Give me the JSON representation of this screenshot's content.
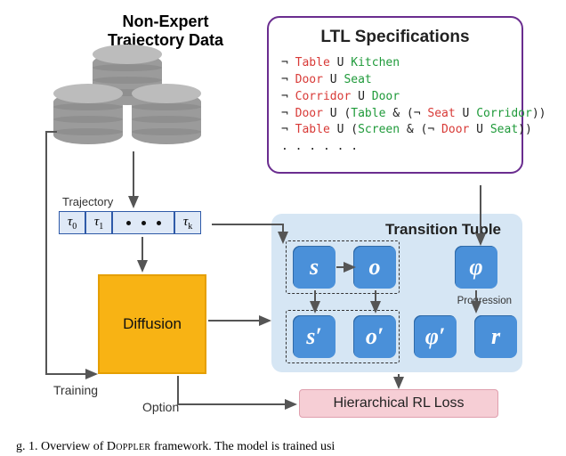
{
  "headers": {
    "nonexpert_line1": "Non-Expert",
    "nonexpert_line2": "Trajectory Data",
    "ltl": "LTL Specifications",
    "trajectory": "Trajectory",
    "transition": "Transition Tuple",
    "diffusion": "Diffusion",
    "progression": "Progression",
    "rl_loss": "Hierarchical RL Loss",
    "training": "Training",
    "option": "Option"
  },
  "ltl_specs": [
    [
      {
        "op": "¬ "
      },
      {
        "red": "Table"
      },
      {
        "op": " U "
      },
      {
        "grn": "Kitchen"
      }
    ],
    [
      {
        "op": "¬ "
      },
      {
        "red": "Door"
      },
      {
        "op": " U "
      },
      {
        "grn": "Seat"
      }
    ],
    [
      {
        "op": "¬ "
      },
      {
        "red": "Corridor"
      },
      {
        "op": " U "
      },
      {
        "grn": "Door"
      }
    ],
    [
      {
        "op": "¬ "
      },
      {
        "red": "Door"
      },
      {
        "op": " U ("
      },
      {
        "grn": "Table"
      },
      {
        "op": " & (¬ "
      },
      {
        "red": "Seat"
      },
      {
        "op": " U "
      },
      {
        "grn": "Corridor"
      },
      {
        "op": "))"
      }
    ],
    [
      {
        "op": "¬ "
      },
      {
        "red": "Table"
      },
      {
        "op": " U ("
      },
      {
        "grn": "Screen"
      },
      {
        "op": " & (¬ "
      },
      {
        "red": "Door"
      },
      {
        "op": " U "
      },
      {
        "grn": "Seat"
      },
      {
        "op": "))"
      }
    ],
    [
      {
        "op": ". . . . . ."
      }
    ]
  ],
  "trajectory": {
    "items": [
      "τ0",
      "τ1",
      "...",
      "τk"
    ]
  },
  "nodes": {
    "s": "s",
    "o": "o",
    "phi": "φ",
    "sp": "s′",
    "op": "o′",
    "phip": "φ′",
    "r": "r"
  },
  "caption": {
    "prefix": "g. 1.   Overview of ",
    "name": "Doppler",
    "suffix": " framework. The model is trained usi"
  }
}
